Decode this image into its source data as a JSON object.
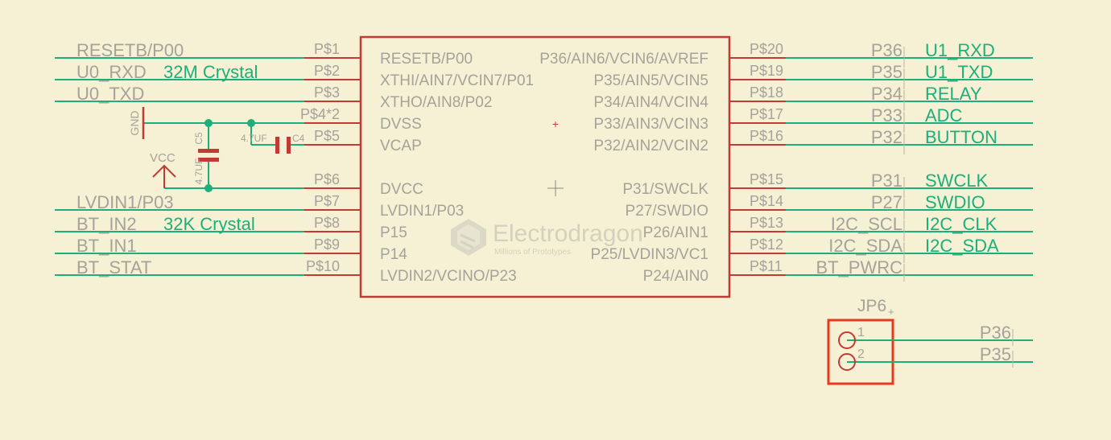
{
  "chip": {
    "left_pins": [
      {
        "num": "P$1",
        "name": "RESETB/P00"
      },
      {
        "num": "P$2",
        "name": "XTHI/AIN7/VCIN7/P01"
      },
      {
        "num": "P$3",
        "name": "XTHO/AIN8/P02"
      },
      {
        "num": "P$4*2",
        "name": "DVSS"
      },
      {
        "num": "P$5",
        "name": "VCAP"
      },
      {
        "num": "P$6",
        "name": "DVCC"
      },
      {
        "num": "P$7",
        "name": "LVDIN1/P03"
      },
      {
        "num": "P$8",
        "name": "P15"
      },
      {
        "num": "P$9",
        "name": "P14"
      },
      {
        "num": "P$10",
        "name": "LVDIN2/VCINO/P23"
      }
    ],
    "right_pins": [
      {
        "num": "P$20",
        "name": "P36/AIN6/VCIN6/AVREF"
      },
      {
        "num": "P$19",
        "name": "P35/AIN5/VCIN5"
      },
      {
        "num": "P$18",
        "name": "P34/AIN4/VCIN4"
      },
      {
        "num": "P$17",
        "name": "P33/AIN3/VCIN3"
      },
      {
        "num": "P$16",
        "name": "P32/AIN2/VCIN2"
      },
      {
        "num": "P$15",
        "name": "P31/SWCLK"
      },
      {
        "num": "P$14",
        "name": "P27/SWDIO"
      },
      {
        "num": "P$13",
        "name": "P26/AIN1"
      },
      {
        "num": "P$12",
        "name": "P25/LVDIN3/VC1"
      },
      {
        "num": "P$11",
        "name": "P24/AIN0"
      }
    ]
  },
  "left_nets": [
    {
      "label": "RESETB/P00",
      "note": ""
    },
    {
      "label": "U0_RXD",
      "note": "32M Crystal"
    },
    {
      "label": "U0_TXD",
      "note": ""
    },
    {
      "label": "LVDIN1/P03",
      "note": ""
    },
    {
      "label": "BT_IN2",
      "note": "32K Crystal"
    },
    {
      "label": "BT_IN1",
      "note": ""
    },
    {
      "label": "BT_STAT",
      "note": ""
    }
  ],
  "right_nets": [
    {
      "port": "P36",
      "net": "U1_RXD"
    },
    {
      "port": "P35",
      "net": "U1_TXD"
    },
    {
      "port": "P34",
      "net": "RELAY"
    },
    {
      "port": "P33",
      "net": "ADC"
    },
    {
      "port": "P32",
      "net": "BUTTON"
    },
    {
      "port": "P31",
      "net": "SWCLK"
    },
    {
      "port": "P27",
      "net": "SWDIO"
    },
    {
      "port": "I2C_SCL",
      "net": "I2C_CLK"
    },
    {
      "port": "I2C_SDA",
      "net": "I2C_SDA"
    },
    {
      "port": "BT_PWRC",
      "net": ""
    }
  ],
  "power": {
    "gnd": "GND",
    "vcc": "VCC"
  },
  "caps": {
    "c5": {
      "name": "C5",
      "value": "4.7UF"
    },
    "c4": {
      "name": "C4",
      "value": "4.7UF"
    }
  },
  "jp6": {
    "name": "JP6",
    "pins": [
      {
        "num": "1",
        "net": "P36"
      },
      {
        "num": "2",
        "net": "P35"
      }
    ]
  },
  "watermark": {
    "brand": "Electrodragon",
    "tagline": "Millions of Prototypes"
  },
  "colors": {
    "background": "#f6f1d4",
    "wire": "#1eae7c",
    "part": "#c23a33",
    "label": "#a5a29a",
    "junction": "#1eae7c"
  }
}
